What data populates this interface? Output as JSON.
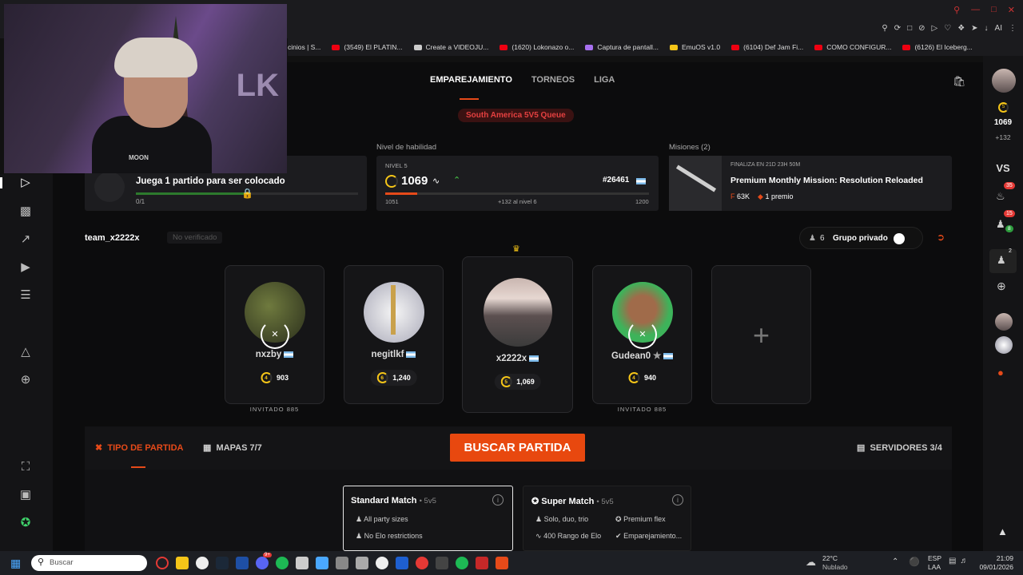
{
  "bookmarks": [
    "cinios | S...",
    "(3549) El PLATIN...",
    "Create a VIDEOJU...",
    "(1620) Lokonazo o...",
    "Captura de pantall...",
    "EmuOS v1.0",
    "(6104) Def Jam Fi...",
    "COMO CONFIGUR...",
    "(6126) El Iceberg..."
  ],
  "toolbar": {
    "ai_label": "AI"
  },
  "webcam": {
    "shirt_text": "MOON",
    "wall_text": "LK"
  },
  "tabs": [
    {
      "label": "EMPAREJAMIENTO"
    },
    {
      "label": "TORNEOS"
    },
    {
      "label": "LIGA"
    }
  ],
  "queue_label": "South America 5V5 Queue",
  "placement": {
    "title": "Juega 1 partido para ser colocado",
    "progress": "0/1"
  },
  "skill": {
    "section": "Nivel de habilidad",
    "level_label": "NIVEL 5",
    "elo": "1069",
    "rank": "#26461",
    "min": "1051",
    "delta_text": "+132 al nivel 6",
    "max": "1200",
    "progress": 0.12
  },
  "missions": {
    "section": "Misiones (2)",
    "ends": "FINALIZA EN 21D 23H 50M",
    "title": "Premium Monthly Mission: Resolution Reloaded",
    "reward_points": "63K",
    "reward_prize": "1 premio"
  },
  "team": {
    "name": "team_x2222x",
    "status": "No verificado",
    "group_count": "6",
    "group_label": "Grupo privado"
  },
  "players": [
    {
      "name": "nxzby",
      "level": "4",
      "elo": "903",
      "invited": "INVITADO 885"
    },
    {
      "name": "negitlkf",
      "level": "6",
      "elo": "1,240",
      "invited": ""
    },
    {
      "name": "x2222x",
      "level": "5",
      "elo": "1,069",
      "invited": ""
    },
    {
      "name": "Gudean0",
      "level": "4",
      "elo": "940",
      "invited": "INVITADO 885"
    }
  ],
  "panel": {
    "match_type": "TIPO DE PARTIDA",
    "maps": "MAPAS 7/7",
    "search": "BUSCAR PARTIDA",
    "servers": "SERVIDORES 3/4"
  },
  "standard": {
    "title": "Standard Match",
    "mode": "• 5v5",
    "feat1": "All party sizes",
    "feat2": "No Elo restrictions"
  },
  "super": {
    "title": "Super Match",
    "mode": "• 5v5",
    "feat1": "Solo, duo, trio",
    "feat2": "Premium flex",
    "feat3": "400 Rango de Elo",
    "feat4": "Emparejamiento..."
  },
  "right": {
    "elo": "1069",
    "delta": "+132",
    "level": "5",
    "vs": "VS",
    "notif_count": "35",
    "friends_count": "15",
    "friends_online": "8",
    "party_count": "2"
  },
  "taskbar": {
    "search": "Buscar",
    "weather_temp": "22°C",
    "weather_desc": "Nublado",
    "lang1": "ESP",
    "lang2": "LAA",
    "time": "21:09",
    "date": "09/01/2026",
    "discord_badge": "9+"
  }
}
